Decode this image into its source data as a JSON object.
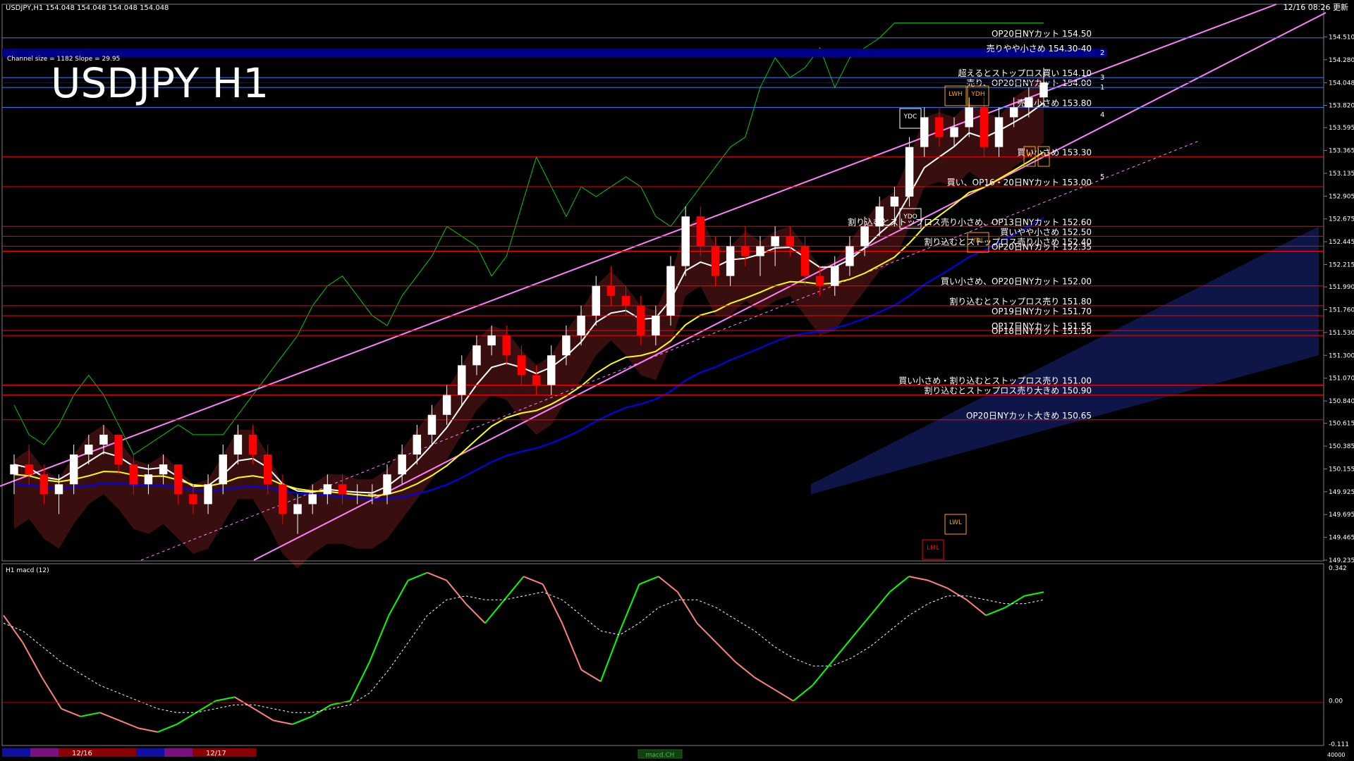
{
  "window": {
    "header_info": "USDJPY,H1  154.048 154.048 154.048 154.048",
    "timestamp": "12/16 08:26 更新",
    "channel_info": "Channel size = 1182 Slope = 29.95",
    "big_title": "USDJPY H1",
    "macd_label": "H1  macd (12)",
    "bottom_tab": "macd.CH",
    "bottom_scale": "40000",
    "date_labels": [
      "12/16",
      "12/17"
    ]
  },
  "colors": {
    "background": "#000000",
    "price_line": "#0000ff",
    "highlight_bar": "#00008b",
    "pink_channel": "#ff80ff",
    "ma_fast": "#ffffff",
    "ma_mid": "#ffff00",
    "ma_slow": "#0000ff",
    "chikou": "#00cc00",
    "cloud_red": "#ff4040",
    "cloud_blue": "#3050ff",
    "level_red": "#ff0000",
    "macd_green": "#00ff00",
    "macd_pink": "#ff8080"
  },
  "chart_data": [
    {
      "type": "candlestick",
      "title": "USDJPY H1",
      "ylim": [
        149.235,
        154.74
      ],
      "y_ticks": [
        "154.510",
        "154.280",
        "154.048",
        "153.820",
        "153.595",
        "153.365",
        "153.135",
        "152.905",
        "152.675",
        "152.445",
        "152.215",
        "151.990",
        "151.760",
        "151.530",
        "151.300",
        "151.070",
        "150.840",
        "150.615",
        "150.385",
        "150.155",
        "149.925",
        "149.695",
        "149.465",
        "149.235"
      ],
      "current_price": 154.048,
      "levels": [
        {
          "price": 154.5,
          "text": "OP20日NYカット 154.50"
        },
        {
          "price": 154.35,
          "text": "売りやや小さめ 154.30-40",
          "highlight": true,
          "tag": "2"
        },
        {
          "price": 154.1,
          "text": "超えるとストップロス買い 154.10",
          "tag": "3"
        },
        {
          "price": 154.0,
          "text": "売り、OP20日NYカット 154.00",
          "tag": "1"
        },
        {
          "price": 153.8,
          "text": "売り小さめ 153.80"
        },
        {
          "price": 153.3,
          "text": "買い小さめ 153.30"
        },
        {
          "price": 153.0,
          "text": "買い、OP16・20日NYカット 153.00"
        },
        {
          "price": 152.6,
          "text": "割り込むとストップロス売り小さめ、OP13日NYカット 152.60"
        },
        {
          "price": 152.5,
          "text": "買いやや小さめ 152.50"
        },
        {
          "price": 152.4,
          "text": "割り込むとストップロス売り小さめ 152.40"
        },
        {
          "price": 152.35,
          "text": "OP20日NYカット 152.35"
        },
        {
          "price": 152.0,
          "text": "買い小さめ、OP20日NYカット 152.00"
        },
        {
          "price": 151.8,
          "text": "割り込むとストップロス売り 151.80"
        },
        {
          "price": 151.7,
          "text": "OP19日NYカット 151.70"
        },
        {
          "price": 151.55,
          "text": "OP17日NYカット 151.55"
        },
        {
          "price": 151.5,
          "text": "OP18日NYカット 151.50"
        },
        {
          "price": 151.0,
          "text": "買い小さめ・割り込むとストップロス売り 151.00"
        },
        {
          "price": 150.9,
          "text": "割り込むとストップロス売り大きめ 150.90"
        },
        {
          "price": 150.65,
          "text": "OP20日NYカット大きめ 150.65"
        }
      ],
      "marker_boxes": [
        "YDC",
        "LWH",
        "YDH",
        "YDO",
        "YDL",
        "LWL",
        "LML",
        "W",
        "D"
      ],
      "channel_tags": [
        "4",
        "5"
      ],
      "candles": [
        [
          150.1,
          150.3,
          149.9,
          150.2
        ],
        [
          150.2,
          150.4,
          150.0,
          150.1
        ],
        [
          150.1,
          150.2,
          149.8,
          149.9
        ],
        [
          149.9,
          150.1,
          149.7,
          150.0
        ],
        [
          150.0,
          150.4,
          149.9,
          150.3
        ],
        [
          150.3,
          150.5,
          150.2,
          150.4
        ],
        [
          150.4,
          150.6,
          150.3,
          150.5
        ],
        [
          150.5,
          150.5,
          150.1,
          150.2
        ],
        [
          150.2,
          150.3,
          149.9,
          150.0
        ],
        [
          150.0,
          150.2,
          149.9,
          150.1
        ],
        [
          150.1,
          150.3,
          150.0,
          150.2
        ],
        [
          150.2,
          150.2,
          149.8,
          149.9
        ],
        [
          149.9,
          150.0,
          149.7,
          149.8
        ],
        [
          149.8,
          150.1,
          149.7,
          150.0
        ],
        [
          150.0,
          150.4,
          149.9,
          150.3
        ],
        [
          150.3,
          150.6,
          150.2,
          150.5
        ],
        [
          150.5,
          150.6,
          150.2,
          150.3
        ],
        [
          150.3,
          150.4,
          149.9,
          150.0
        ],
        [
          150.0,
          150.1,
          149.6,
          149.7
        ],
        [
          149.7,
          149.9,
          149.5,
          149.8
        ],
        [
          149.8,
          150.0,
          149.7,
          149.9
        ],
        [
          149.9,
          150.1,
          149.8,
          150.0
        ],
        [
          150.0,
          150.1,
          149.8,
          149.9
        ],
        [
          149.9,
          150.0,
          149.8,
          149.9
        ],
        [
          149.9,
          150.0,
          149.8,
          149.9
        ],
        [
          149.9,
          150.2,
          149.8,
          150.1
        ],
        [
          150.1,
          150.4,
          150.0,
          150.3
        ],
        [
          150.3,
          150.6,
          150.2,
          150.5
        ],
        [
          150.5,
          150.8,
          150.4,
          150.7
        ],
        [
          150.7,
          151.0,
          150.6,
          150.9
        ],
        [
          150.9,
          151.3,
          150.8,
          151.2
        ],
        [
          151.2,
          151.5,
          151.1,
          151.4
        ],
        [
          151.4,
          151.6,
          151.3,
          151.5
        ],
        [
          151.5,
          151.6,
          151.2,
          151.3
        ],
        [
          151.3,
          151.4,
          151.0,
          151.1
        ],
        [
          151.1,
          151.2,
          150.9,
          151.0
        ],
        [
          151.0,
          151.4,
          150.9,
          151.3
        ],
        [
          151.3,
          151.6,
          151.2,
          151.5
        ],
        [
          151.5,
          151.8,
          151.4,
          151.7
        ],
        [
          151.7,
          152.1,
          151.6,
          152.0
        ],
        [
          152.0,
          152.2,
          151.8,
          151.9
        ],
        [
          151.9,
          152.0,
          151.7,
          151.8
        ],
        [
          151.8,
          151.9,
          151.4,
          151.5
        ],
        [
          151.5,
          151.8,
          151.4,
          151.7
        ],
        [
          151.7,
          152.3,
          151.6,
          152.2
        ],
        [
          152.2,
          152.8,
          152.1,
          152.7
        ],
        [
          152.7,
          152.8,
          152.3,
          152.4
        ],
        [
          152.4,
          152.5,
          152.0,
          152.1
        ],
        [
          152.1,
          152.5,
          152.0,
          152.4
        ],
        [
          152.4,
          152.6,
          152.2,
          152.3
        ],
        [
          152.3,
          152.5,
          152.1,
          152.4
        ],
        [
          152.4,
          152.6,
          152.2,
          152.5
        ],
        [
          152.5,
          152.6,
          152.3,
          152.4
        ],
        [
          152.4,
          152.5,
          152.0,
          152.1
        ],
        [
          152.1,
          152.2,
          151.9,
          152.0
        ],
        [
          152.0,
          152.3,
          151.9,
          152.2
        ],
        [
          152.2,
          152.5,
          152.1,
          152.4
        ],
        [
          152.4,
          152.7,
          152.3,
          152.6
        ],
        [
          152.6,
          152.9,
          152.5,
          152.8
        ],
        [
          152.8,
          153.0,
          152.6,
          152.9
        ],
        [
          152.9,
          153.5,
          152.8,
          153.4
        ],
        [
          153.4,
          153.8,
          153.3,
          153.7
        ],
        [
          153.7,
          153.8,
          153.4,
          153.5
        ],
        [
          153.5,
          153.7,
          153.4,
          153.6
        ],
        [
          153.6,
          153.9,
          153.5,
          153.8
        ],
        [
          153.8,
          153.9,
          153.3,
          153.4
        ],
        [
          153.4,
          153.8,
          153.3,
          153.7
        ],
        [
          153.7,
          153.9,
          153.6,
          153.8
        ],
        [
          153.8,
          154.0,
          153.7,
          153.9
        ],
        [
          153.9,
          154.2,
          153.8,
          154.05
        ]
      ]
    },
    {
      "type": "line",
      "title": "H1  macd (12)",
      "ylim": [
        -0.111,
        0.342
      ],
      "y_ticks": [
        "0.342",
        "0.00",
        "-0.111"
      ],
      "series": [
        {
          "values": [
            0.22,
            0.15,
            0.06,
            -0.02,
            -0.04,
            -0.03,
            -0.05,
            -0.07,
            -0.08,
            -0.06,
            -0.03,
            0.0,
            0.01,
            -0.02,
            -0.05,
            -0.06,
            -0.04,
            -0.01,
            0.0,
            0.1,
            0.22,
            0.31,
            0.33,
            0.31,
            0.25,
            0.2,
            0.26,
            0.32,
            0.3,
            0.2,
            0.08,
            0.05,
            0.18,
            0.3,
            0.32,
            0.28,
            0.2,
            0.15,
            0.1,
            0.06,
            0.03,
            0.0,
            0.04,
            0.1,
            0.16,
            0.22,
            0.28,
            0.32,
            0.31,
            0.29,
            0.26,
            0.22,
            0.24,
            0.27,
            0.28
          ]
        },
        {
          "values": [
            0.2,
            0.18,
            0.14,
            0.1,
            0.07,
            0.04,
            0.02,
            0.0,
            -0.02,
            -0.03,
            -0.03,
            -0.02,
            -0.01,
            -0.01,
            -0.02,
            -0.03,
            -0.03,
            -0.02,
            -0.01,
            0.02,
            0.08,
            0.15,
            0.22,
            0.26,
            0.27,
            0.26,
            0.26,
            0.27,
            0.28,
            0.26,
            0.22,
            0.18,
            0.17,
            0.2,
            0.24,
            0.26,
            0.26,
            0.24,
            0.21,
            0.18,
            0.14,
            0.11,
            0.09,
            0.09,
            0.11,
            0.14,
            0.18,
            0.22,
            0.25,
            0.27,
            0.27,
            0.26,
            0.25,
            0.25,
            0.26
          ]
        }
      ]
    }
  ]
}
